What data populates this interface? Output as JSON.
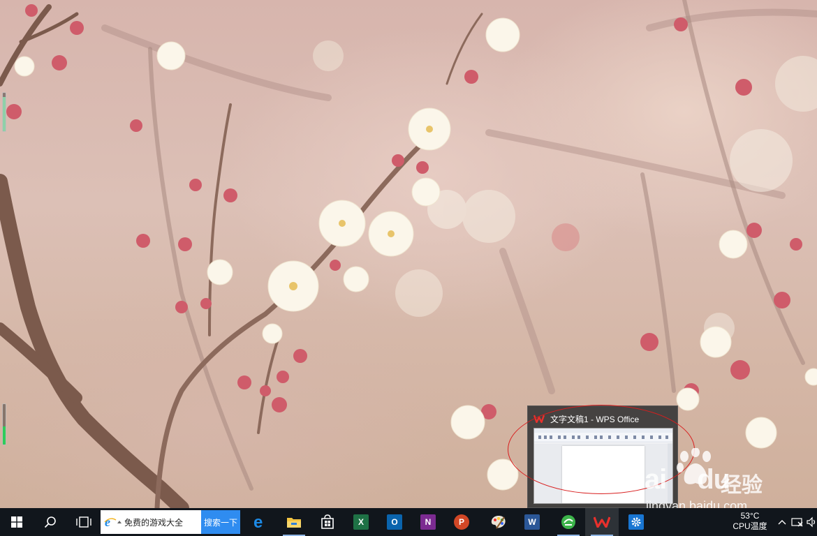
{
  "desktop": {
    "wallpaper": "plum-blossom-branches"
  },
  "preview": {
    "window_title": "文字文稿1 - WPS Office",
    "app_icon": "wps-writer-icon",
    "annotation_color": "#d81e1e"
  },
  "watermark": {
    "logo_text": "Bai",
    "logo_text_after": "du",
    "chinese_text": "经验",
    "url": "jingyan.baidu.com"
  },
  "taskbar": {
    "start_icon": "windows-logo-icon",
    "search_icon": "search-icon",
    "task_view_icon": "task-view-icon",
    "ie_search": {
      "icon": "internet-explorer-icon",
      "text": "免费的游戏大全",
      "button_label": "搜索一下"
    },
    "pinned_apps": [
      {
        "name": "edge",
        "icon": "edge-icon"
      },
      {
        "name": "file-explorer",
        "icon": "file-explorer-icon"
      },
      {
        "name": "store",
        "icon": "store-icon"
      },
      {
        "name": "excel",
        "icon": "excel-icon",
        "letter": "X",
        "color": "#1e7145"
      },
      {
        "name": "outlook",
        "icon": "outlook-icon",
        "letter": "O",
        "color": "#0a64ad"
      },
      {
        "name": "onenote",
        "icon": "onenote-icon",
        "letter": "N",
        "color": "#7c2b91"
      },
      {
        "name": "powerpoint",
        "icon": "powerpoint-icon",
        "letter": "P",
        "color": "#d24726"
      },
      {
        "name": "paint",
        "icon": "paint-palette-icon"
      },
      {
        "name": "word",
        "icon": "word-icon",
        "letter": "W",
        "color": "#2b5797"
      },
      {
        "name": "360-browser",
        "icon": "green-browser-icon"
      },
      {
        "name": "wps-office",
        "icon": "wps-icon",
        "active": true
      },
      {
        "name": "settings",
        "icon": "gear-icon"
      }
    ],
    "cpu": {
      "temperature": "53°C",
      "label": "CPU温度"
    },
    "tray": {
      "chevron_icon": "chevron-up-icon",
      "network_icon": "network-disconnected-icon",
      "volume_icon": "speaker-icon"
    }
  },
  "gauges": {
    "left_upper_level": 0.9,
    "left_lower_level": 0.45
  }
}
